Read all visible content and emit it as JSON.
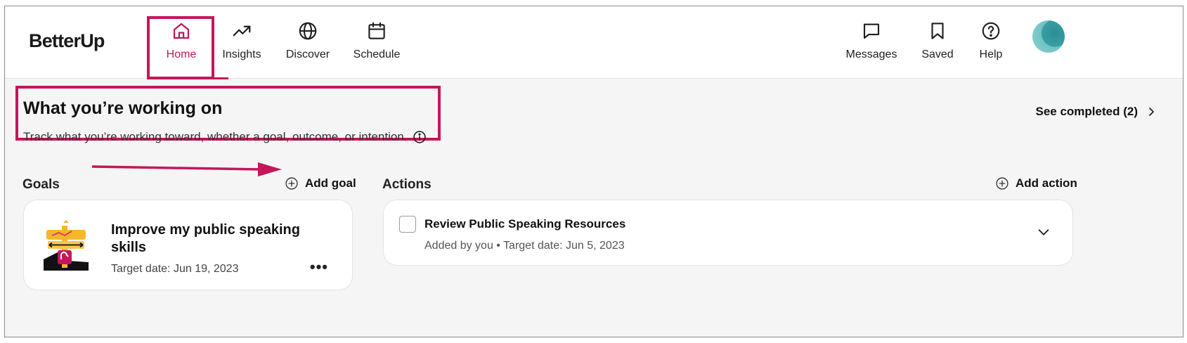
{
  "brand": {
    "logo_text": "BetterUp",
    "accent_color": "#c4175a"
  },
  "nav": {
    "left": [
      {
        "label": "Home",
        "icon": "home-icon",
        "active": true
      },
      {
        "label": "Insights",
        "icon": "trending-up-icon",
        "active": false
      },
      {
        "label": "Discover",
        "icon": "globe-icon",
        "active": false
      },
      {
        "label": "Schedule",
        "icon": "calendar-icon",
        "active": false
      }
    ],
    "right": [
      {
        "label": "Messages",
        "icon": "chat-icon"
      },
      {
        "label": "Saved",
        "icon": "bookmark-icon"
      },
      {
        "label": "Help",
        "icon": "help-icon"
      }
    ],
    "avatar_icon": "avatar"
  },
  "section": {
    "title": "What you’re working on",
    "subtitle": "Track what you’re working toward, whether a goal, outcome, or intention.",
    "see_completed": "See completed (2)"
  },
  "goals": {
    "title": "Goals",
    "add_label": "Add goal",
    "items": [
      {
        "title": "Improve my public speaking skills",
        "target_date": "Target date: Jun 19, 2023",
        "more_label": "•••"
      }
    ]
  },
  "actions": {
    "title": "Actions",
    "add_label": "Add action",
    "items": [
      {
        "title": "Review Public Speaking Resources",
        "meta": "Added by you • Target date: Jun 5, 2023"
      }
    ]
  }
}
